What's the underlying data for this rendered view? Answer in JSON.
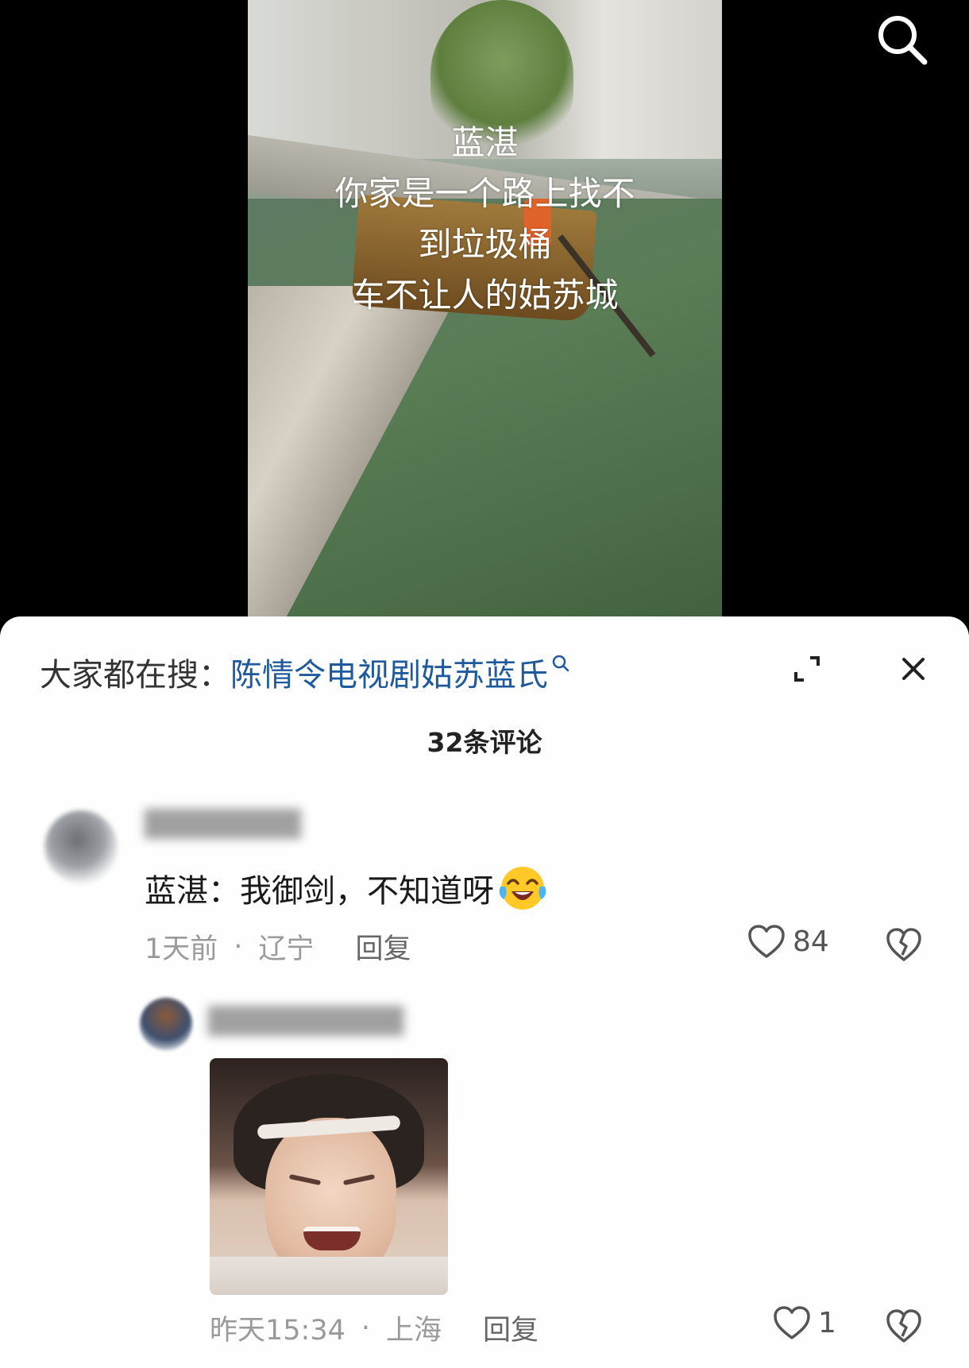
{
  "video": {
    "caption": "蓝湛\n你家是一个路上找不\n到垃圾桶\n车不让人的姑苏城"
  },
  "sheet": {
    "trending_prefix": "大家都在搜：",
    "trending_query": "陈情令电视剧姑苏蓝氏",
    "comment_count": "32条评论"
  },
  "comments": [
    {
      "username": "",
      "text": "蓝湛：我御剑，不知道呀",
      "emoji": "laughing-crying-face-icon",
      "time": "1天前",
      "location": "辽宁",
      "reply_label": "回复",
      "likes": "84",
      "replies": [
        {
          "username": "",
          "image": "crying-face-photo",
          "time": "昨天15:34",
          "location": "上海",
          "reply_label": "回复",
          "likes": "1"
        }
      ]
    }
  ],
  "colors": {
    "link": "#1f5a9c",
    "meta": "#9a9a9a",
    "text": "#1a1a1a"
  }
}
